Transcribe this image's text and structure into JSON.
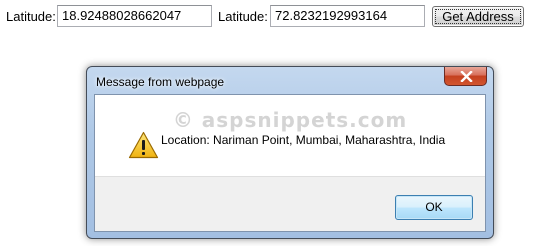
{
  "form": {
    "latitude_label_1": "Latitude:",
    "latitude_value_1": "18.92488028662047",
    "latitude_label_2": "Latitude:",
    "latitude_value_2": "72.8232192993164",
    "get_address_label": "Get Address"
  },
  "dialog": {
    "title": "Message from webpage",
    "watermark": "© aspsnippets.com",
    "message": "Location: Nariman Point, Mumbai, Maharashtra, India",
    "ok_label": "OK",
    "icon": "warning-icon"
  },
  "colors": {
    "dialog_frame": "#aec8e6",
    "close_button": "#c4401f",
    "warning_yellow": "#f5c318"
  }
}
